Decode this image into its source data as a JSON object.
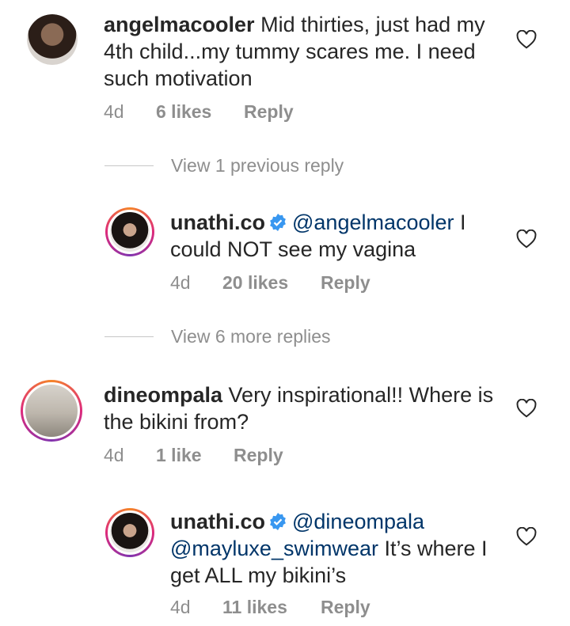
{
  "comments": [
    {
      "username": "angelmacooler",
      "text": " Mid thirties, just had my 4th child...my tummy scares me. I need such motivation",
      "time": "4d",
      "likes": "6 likes",
      "reply": "Reply"
    },
    {
      "username": "unathi.co",
      "verified": true,
      "mention": "@angelmacooler",
      "text": " I could NOT see my vagina",
      "time": "4d",
      "likes": "20 likes",
      "reply": "Reply"
    },
    {
      "username": "dineompala",
      "text": " Very inspirational!! Where is the bikini from?",
      "time": "4d",
      "likes": "1 like",
      "reply": "Reply"
    },
    {
      "username": "unathi.co",
      "verified": true,
      "mention": "@dineompala",
      "mention2": "@mayluxe_swimwear",
      "text": " It’s where I get ALL my bikini’s",
      "time": "4d",
      "likes": "11 likes",
      "reply": "Reply"
    }
  ],
  "view_previous": "View 1 previous reply",
  "view_more": "View 6 more replies",
  "colors": {
    "mention": "#003569",
    "verified": "#3897f0",
    "meta": "#8e8e8e"
  },
  "icons": [
    "heart-icon",
    "verified-badge-icon"
  ]
}
